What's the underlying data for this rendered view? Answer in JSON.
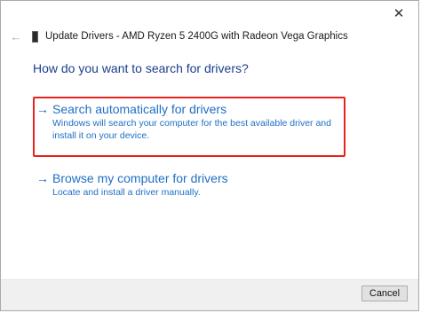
{
  "window": {
    "title": "Update Drivers - AMD Ryzen 5 2400G with Radeon Vega Graphics",
    "close_glyph": "✕",
    "back_glyph": "←"
  },
  "main": {
    "heading": "How do you want to search for drivers?",
    "options": [
      {
        "arrow": "→",
        "label": "Search automatically for drivers",
        "description": "Windows will search your computer for the best available driver and install it on your device.",
        "highlighted": true
      },
      {
        "arrow": "→",
        "label": "Browse my computer for drivers",
        "description": "Locate and install a driver manually.",
        "highlighted": false
      }
    ]
  },
  "footer": {
    "cancel_label": "Cancel"
  },
  "colors": {
    "link_blue": "#1f6fc4",
    "heading_blue": "#1a3e8e",
    "highlight_red": "#e8231f"
  },
  "icons": {
    "back": "back-arrow-icon",
    "device": "display-adapter-icon",
    "close": "close-icon",
    "option_arrow": "arrow-right-icon"
  }
}
